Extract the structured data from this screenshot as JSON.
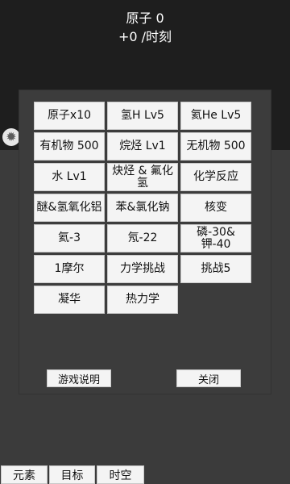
{
  "header": {
    "atoms_label": "原子 0",
    "rate_label": "+0 /时刻"
  },
  "settings": {
    "icon": "gear-icon"
  },
  "panel": {
    "buttons": [
      "原子x10",
      "氢H Lv5",
      "氦He Lv5",
      "有机物 500",
      "烷烃 Lv1",
      "无机物 500",
      "水 Lv1",
      "炔烃 & 氟化氢",
      "化学反应",
      "醚&氢氧化铝",
      "苯&氯化钠",
      "核变",
      "氦-3",
      "氖-22",
      "磷-30&钾-40",
      "1摩尔",
      "力学挑战",
      "挑战5",
      "凝华",
      "热力学"
    ],
    "help_label": "游戏说明",
    "close_label": "关闭"
  },
  "tabs": [
    "元素",
    "目标",
    "时空"
  ]
}
